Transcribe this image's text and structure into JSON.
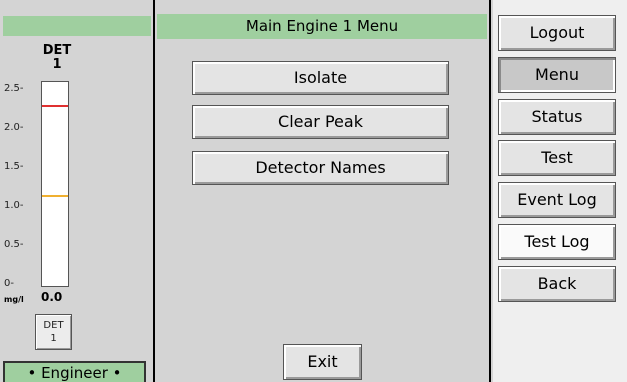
{
  "left_panel": {
    "detector_label": "DET",
    "detector_number": "1",
    "ticks": [
      "2.5-",
      "2.0-",
      "1.5-",
      "1.0-",
      "0.5-",
      "0-"
    ],
    "unit": "mg/l",
    "reading": "0.0",
    "gauge": {
      "max": 2.5,
      "value": 0.0,
      "alarm_high": 2.2,
      "alarm_low": 1.1,
      "alarm_high_color": "#e03030",
      "alarm_low_color": "#f0b030",
      "fill_color": "#2aa52a"
    },
    "det_button": {
      "line1": "DET",
      "line2": "1"
    },
    "role": "• Engineer •"
  },
  "center_panel": {
    "title": "Main Engine 1 Menu",
    "buttons": [
      "Isolate",
      "Clear Peak",
      "Detector Names"
    ],
    "exit_label": "Exit"
  },
  "nav": {
    "buttons": [
      "Logout",
      "Menu",
      "Status",
      "Test",
      "Event Log",
      "Test Log",
      "Back"
    ],
    "active": "Menu"
  },
  "colors": {
    "header_green": "#9fcf9f",
    "panel_gray": "#d4d4d4"
  }
}
